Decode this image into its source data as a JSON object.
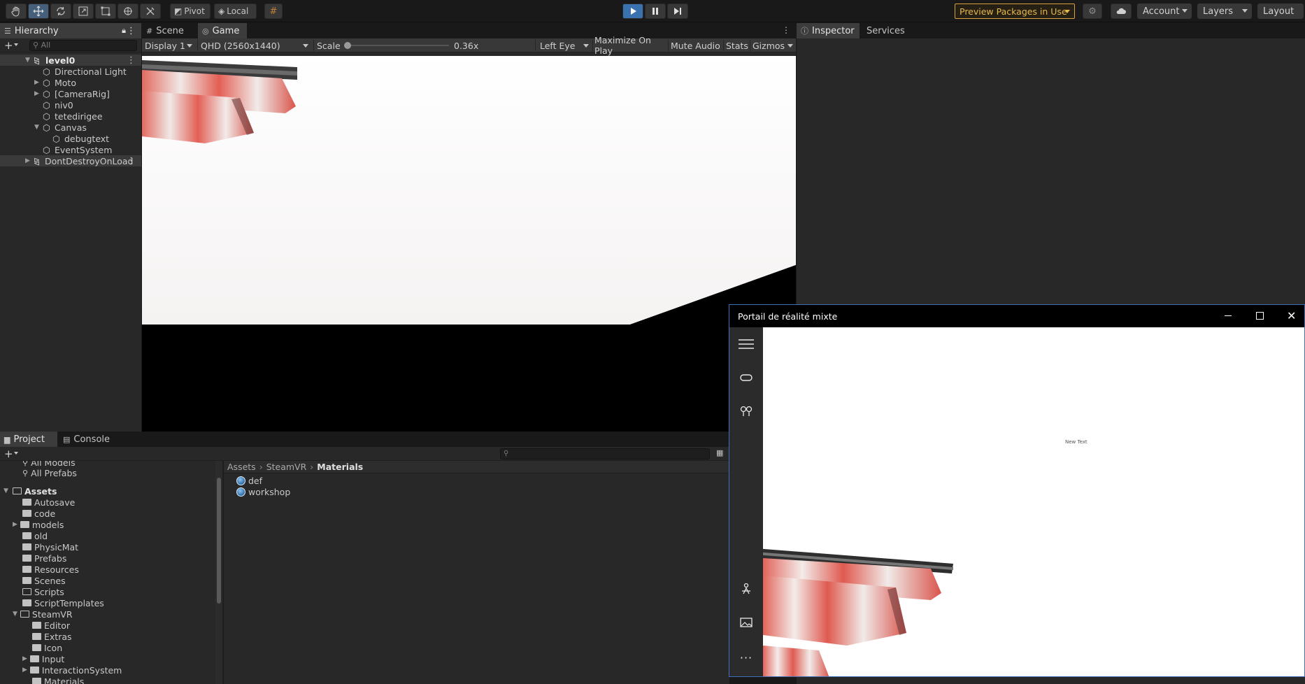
{
  "toolbar": {
    "pivot_label": "Pivot",
    "local_label": "Local",
    "preview_packages_label": "Preview Packages in Use",
    "account_label": "Account",
    "layers_label": "Layers",
    "layout_label": "Layout"
  },
  "hierarchy": {
    "tab_label": "Hierarchy",
    "search_placeholder": "All",
    "items": [
      {
        "label": "level0"
      },
      {
        "label": "Directional Light"
      },
      {
        "label": "Moto"
      },
      {
        "label": "[CameraRig]"
      },
      {
        "label": "niv0"
      },
      {
        "label": "tetedirigee"
      },
      {
        "label": "Canvas"
      },
      {
        "label": "debugtext"
      },
      {
        "label": "EventSystem"
      },
      {
        "label": "DontDestroyOnLoad"
      }
    ]
  },
  "game": {
    "scene_tab": "Scene",
    "game_tab": "Game",
    "display_label": "Display 1",
    "resolution_label": "QHD (2560x1440)",
    "scale_label": "Scale",
    "scale_value": "0.36x",
    "eye_label": "Left Eye",
    "maximize_label": "Maximize On Play",
    "mute_label": "Mute Audio",
    "stats_label": "Stats",
    "gizmos_label": "Gizmos"
  },
  "inspector": {
    "tab_label": "Inspector",
    "services_tab": "Services"
  },
  "project": {
    "tab_label": "Project",
    "console_tab": "Console",
    "favorites": [
      "All Models",
      "All Prefabs"
    ],
    "assets_label": "Assets",
    "folders": [
      "Autosave",
      "code",
      "models",
      "old",
      "PhysicMat",
      "Prefabs",
      "Resources",
      "Scenes",
      "Scripts",
      "ScriptTemplates",
      "SteamVR"
    ],
    "steamvr_children": [
      "Editor",
      "Extras",
      "Icon",
      "Input",
      "InteractionSystem",
      "Materials"
    ],
    "breadcrumb": [
      "Assets",
      "SteamVR",
      "Materials"
    ],
    "files": [
      "def",
      "workshop"
    ]
  },
  "mrp": {
    "title": "Portail de réalité mixte",
    "content_text": "New Text"
  }
}
